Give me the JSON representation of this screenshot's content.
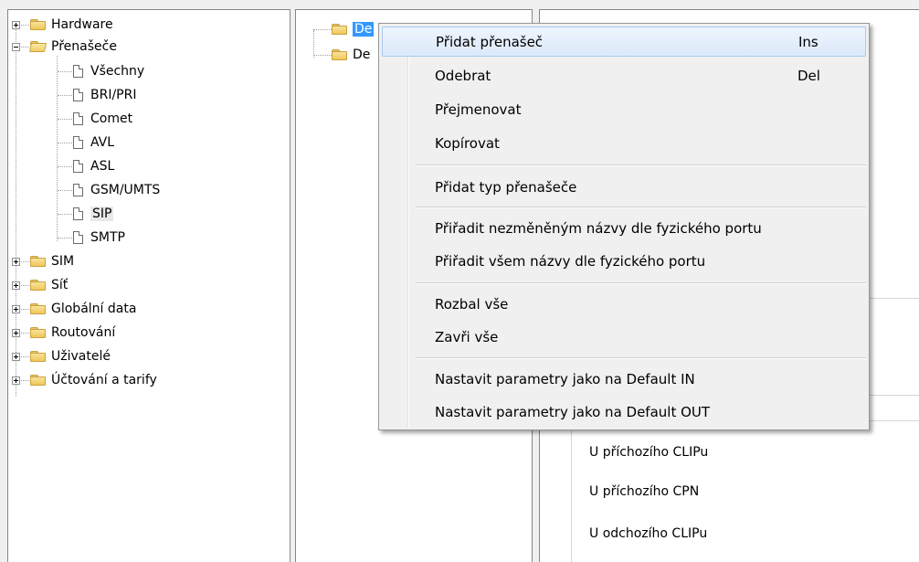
{
  "left_tree": {
    "hardware": "Hardware",
    "prenasece": "Přenašeče",
    "children": [
      "Všechny",
      "BRI/PRI",
      "Comet",
      "AVL",
      "ASL",
      "GSM/UMTS",
      "SIP",
      "SMTP"
    ],
    "sim": "SIM",
    "sit": "Síť",
    "globalni_data": "Globální data",
    "routovani": "Routování",
    "uzivatele": "Uživatelé",
    "uctovani": "Účtování a tarify"
  },
  "mid_tree": {
    "item1": "De",
    "item2": "De"
  },
  "context_menu": {
    "pridat_prenasec": "Přidat přenašeč",
    "pridat_shortcut": "Ins",
    "odebrat": "Odebrat",
    "odebrat_shortcut": "Del",
    "prejmenovat": "Přejmenovat",
    "kopirovat": "Kopírovat",
    "pridat_typ": "Přidat typ přenašeče",
    "priradit_nezmenenym": "Přiřadit nezměněným názvy dle fyzického portu",
    "priradit_vsem": "Přiřadit všem názvy dle fyzického portu",
    "rozbal_vse": "Rozbal vše",
    "zavri_vse": "Zavři vše",
    "nastavit_in": "Nastavit parametry jako na Default IN",
    "nastavit_out": "Nastavit parametry jako na Default OUT"
  },
  "right_panel": {
    "prichozi_clip": "U příchozího CLIPu",
    "prichozi_cpn": "U příchozího CPN",
    "odchozi_clip": "U odchozího CLIPu"
  }
}
